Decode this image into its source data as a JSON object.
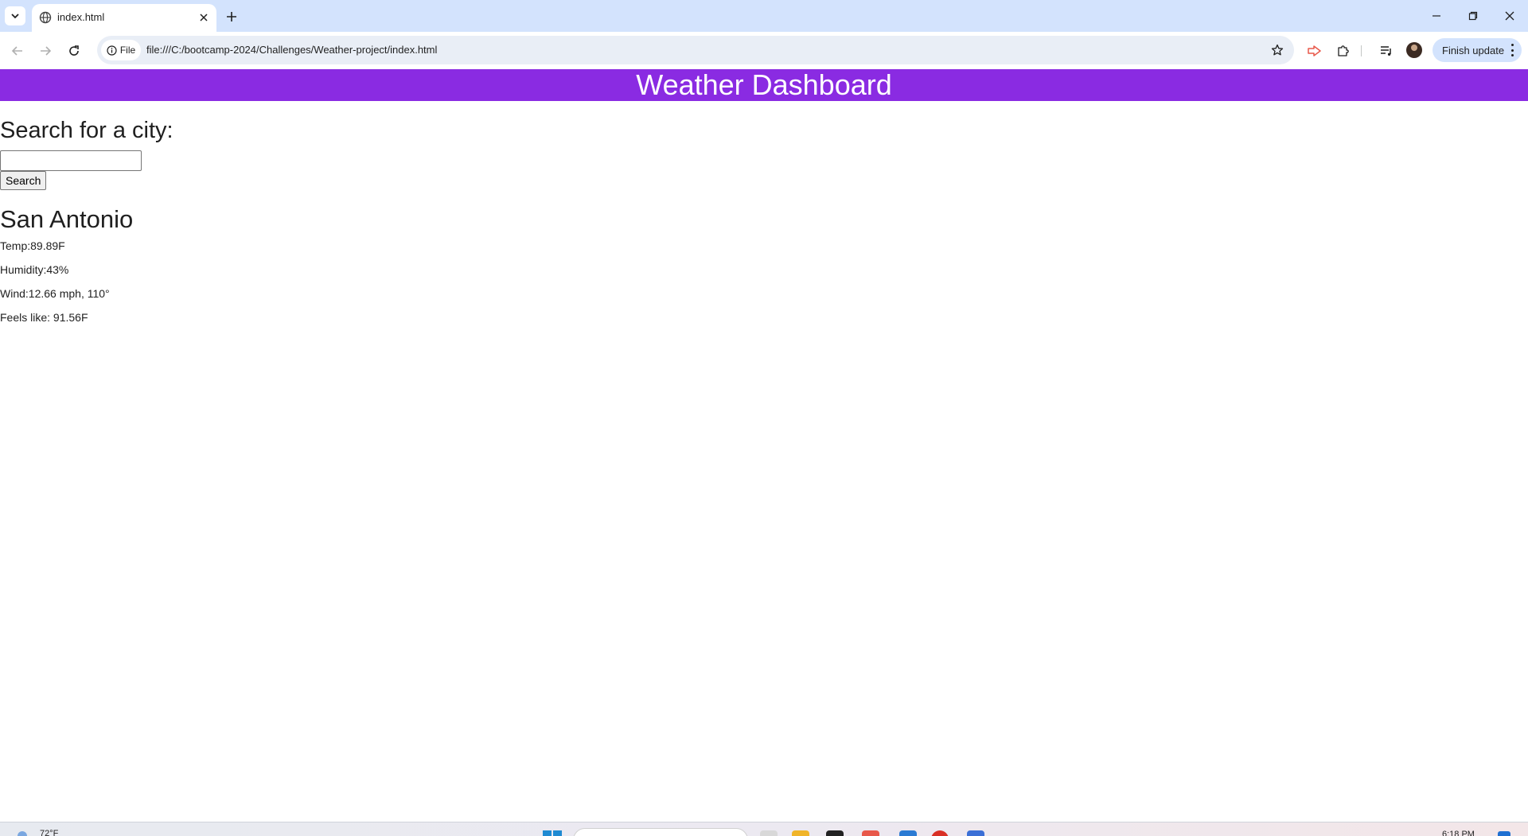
{
  "browser": {
    "tab": {
      "title": "index.html"
    },
    "address_bar": {
      "site_chip_label": "File",
      "url": "file:///C:/bootcamp-2024/Challenges/Weather-project/index.html"
    },
    "finish_update_label": "Finish update"
  },
  "page": {
    "header_title": "Weather Dashboard",
    "search": {
      "heading": "Search for a city:",
      "input_value": "",
      "button_label": "Search"
    },
    "weather": {
      "city": "San Antonio",
      "temp": "Temp:89.89F",
      "humidity": "Humidity:43%",
      "wind": "Wind:12.66 mph, 110°",
      "feels_like": "Feels like: 91.56F"
    }
  },
  "taskbar": {
    "weather": "72°F",
    "clock": "6:18 PM"
  },
  "colors": {
    "header_bg": "#8a2be2",
    "tabstrip_bg": "#d3e3fd",
    "omnibox_bg": "#e9eef6"
  }
}
